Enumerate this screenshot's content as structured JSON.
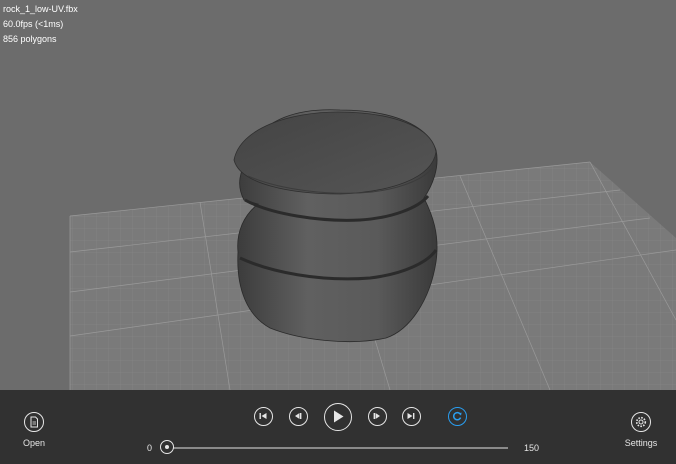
{
  "info": {
    "filename": "rock_1_low-UV.fbx",
    "fps": "60.0fps (<1ms)",
    "polygons": "856 polygons"
  },
  "toolbar": {
    "open_label": "Open",
    "settings_label": "Settings",
    "slider": {
      "min_label": "0",
      "max_label": "150",
      "value": 0
    }
  },
  "colors": {
    "viewport_bg": "#6c6c6c",
    "toolbar_bg": "#313131",
    "loop_accent": "#2a9ef0"
  },
  "icons": {
    "open": "document-icon",
    "settings": "gear-icon",
    "first": "skip-to-start-icon",
    "prev": "step-back-icon",
    "play": "play-icon",
    "next": "step-forward-icon",
    "last": "skip-to-end-icon",
    "loop": "loop-icon"
  }
}
